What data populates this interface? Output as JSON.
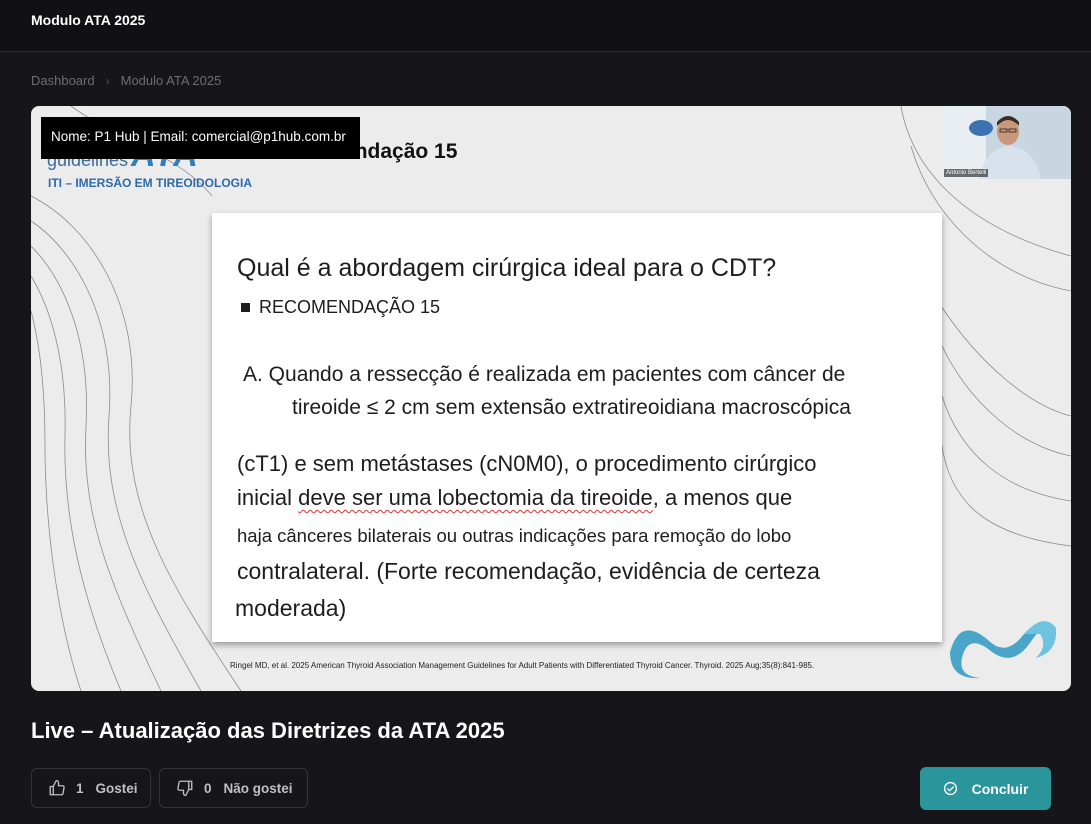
{
  "header": {
    "title": "Modulo ATA 2025"
  },
  "breadcrumb": {
    "items": [
      "Dashboard",
      "Modulo ATA 2025"
    ]
  },
  "video": {
    "watermark": "Nome: P1 Hub | Email: comercial@p1hub.com.br",
    "logo_guidelines": "guidelines",
    "logo_ata": "ATA",
    "logo_subtitle": "ITI – IMERSÃO EM TIREOIDOLOGIA",
    "slide_heading": "Recomendação 15",
    "speaker_name": "Antonio Bertelli",
    "slide": {
      "question": "Qual é a abordagem cirúrgica ideal para o CDT?",
      "recommendation_label": "RECOMENDAÇÃO 15",
      "line1": "A. Quando a ressecção é realizada em pacientes com câncer de",
      "line2": "tireoide ≤ 2 cm sem extensão extratireoidiana macroscópica",
      "line3": "(cT1) e sem metástases (cN0M0), o procedimento cirúrgico",
      "line4_pre": "inicial ",
      "line4_underlined": "deve ser uma lobectomia da tireoide",
      "line4_post": ", a menos que",
      "line5": "haja cânceres bilaterais ou outras indicações para remoção do lobo",
      "line6": "contralateral. (Forte recomendação, evidência de certeza",
      "line7": "moderada)"
    },
    "citation": "Ringel MD, et al. 2025 American Thyroid Association Management Guidelines for Adult Patients with Differentiated Thyroid Cancer. Thyroid. 2025 Aug;35(8):841-985."
  },
  "lesson": {
    "title": "Live – Atualização das Diretrizes da ATA 2025"
  },
  "actions": {
    "like_count": "1",
    "like_label": "Gostei",
    "dislike_count": "0",
    "dislike_label": "Não gostei",
    "conclude_label": "Concluir"
  },
  "colors": {
    "accent": "#2a959a",
    "background": "#16161a"
  }
}
